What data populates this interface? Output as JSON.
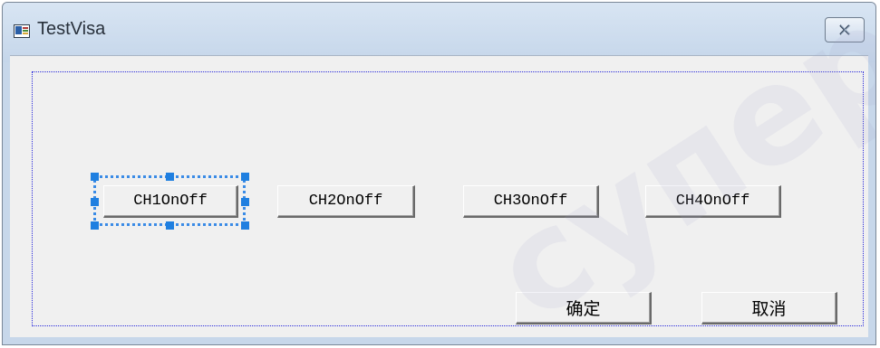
{
  "window": {
    "title": "TestVisa",
    "close_symbol": "✕"
  },
  "buttons": {
    "ch1": "CH1OnOff",
    "ch2": "CH2OnOff",
    "ch3": "CH3OnOff",
    "ch4": "CH4OnOff",
    "ok": "确定",
    "cancel": "取消"
  },
  "selection": {
    "selected_control": "CH1OnOff"
  },
  "watermark": {
    "text": "супер"
  },
  "colors": {
    "titlebar": "#c7d7ea",
    "client_background": "#f0f0f0",
    "selection_handle": "#1f7fe0",
    "focus_rect": "#2b2bdb"
  }
}
